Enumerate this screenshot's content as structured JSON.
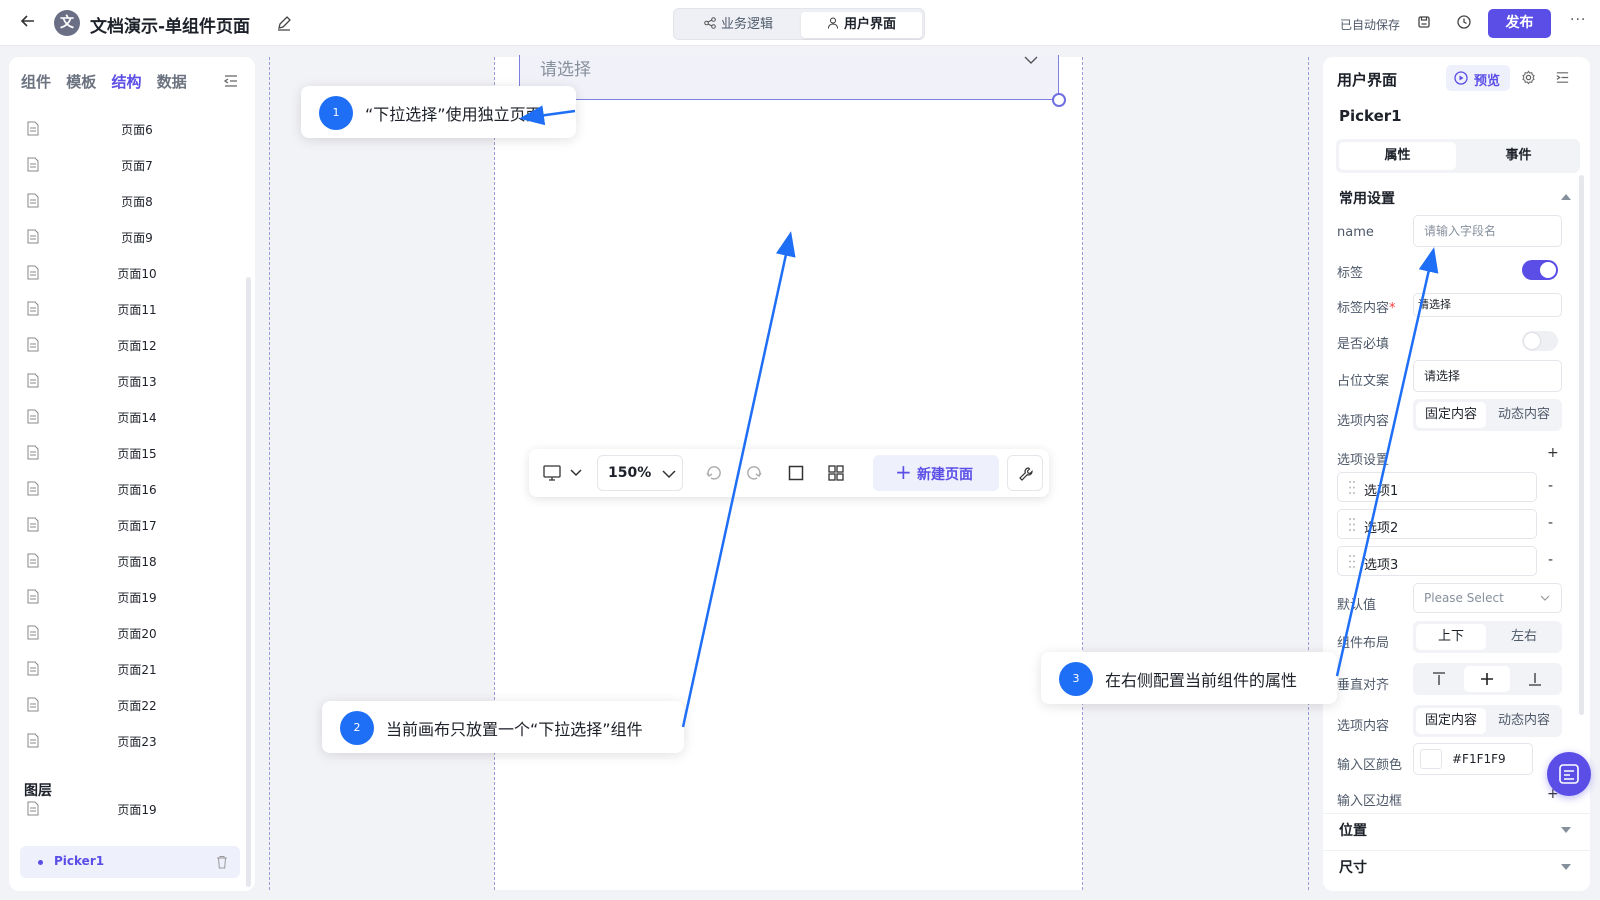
{
  "header": {
    "app_logo": "文",
    "title": "文档演示-单组件页面",
    "modes": [
      "业务逻辑",
      "用户界面"
    ],
    "autosave": "已自动保存",
    "publish_label": "发布",
    "more": "···"
  },
  "left_panel": {
    "tabs": [
      "组件",
      "模板",
      "结构",
      "数据"
    ],
    "active_tab": "结构",
    "pages": [
      "页面6",
      "页面7",
      "页面8",
      "页面9",
      "页面10",
      "页面11",
      "页面12",
      "页面13",
      "页面14",
      "页面15",
      "页面16",
      "页面17",
      "页面18",
      "页面19",
      "页面20",
      "页面21",
      "页面22",
      "页面23"
    ],
    "layers_title": "图层",
    "layer_page": "页面19",
    "layer_component": "Picker1"
  },
  "canvas": {
    "picker_placeholder": "请选择",
    "toolbar": {
      "zoom": "150%",
      "new_page_label": "新建页面"
    }
  },
  "right_panel": {
    "title": "用户界面",
    "preview_label": "预览",
    "component_name": "Picker1",
    "tabs": [
      "属性",
      "事件"
    ],
    "section_common": "常用设置",
    "name_label": "name",
    "name_placeholder": "请输入字段名",
    "tag_label": "标签",
    "tag_content_label": "标签内容",
    "required_mark": "*",
    "tag_content_value": "请选择",
    "required_label": "是否必填",
    "placeholder_label": "占位文案",
    "placeholder_value": "请选择",
    "option_content_label": "选项内容",
    "option_content_choices": [
      "固定内容",
      "动态内容"
    ],
    "option_settings_label": "选项设置",
    "plus": "+",
    "options": [
      "选项1",
      "选项2",
      "选项3"
    ],
    "minus": "-",
    "default_label": "默认值",
    "default_placeholder": "Please Select",
    "layout_label": "组件布局",
    "layout_choices": [
      "上下",
      "左右"
    ],
    "valign_label": "垂直对齐",
    "option_content_label2": "选项内容",
    "input_color_label": "输入区颜色",
    "input_color_value": "#F1F1F9",
    "input_border_label": "输入区边框",
    "section_position": "位置",
    "section_size": "尺寸"
  },
  "callouts": [
    {
      "num": "1",
      "text": "“下拉选择”使用独立页面"
    },
    {
      "num": "2",
      "text": "当前画布只放置一个“下拉选择”组件"
    },
    {
      "num": "3",
      "text": "在右侧配置当前组件的属性"
    }
  ],
  "colors": {
    "accent": "#5b4ee6",
    "callout_blue": "#1e6ff5",
    "input_bg": "#F1F1F9"
  }
}
